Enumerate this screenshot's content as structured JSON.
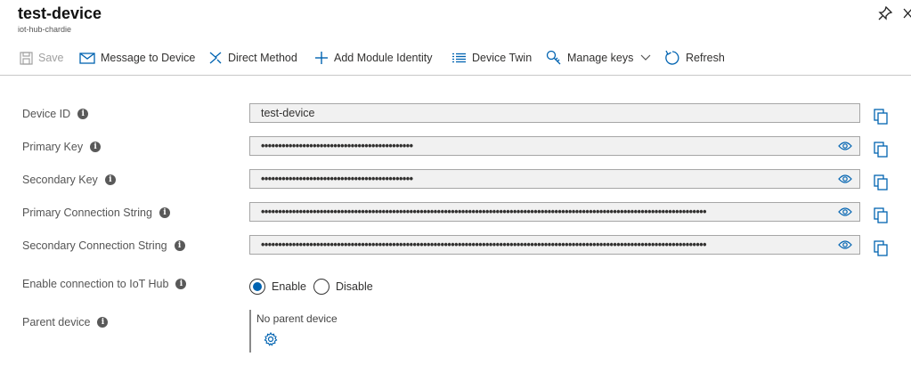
{
  "header": {
    "title": "test-device",
    "subtitle": "iot-hub-chardie"
  },
  "toolbar": {
    "save": "Save",
    "message": "Message to Device",
    "direct": "Direct Method",
    "add_module": "Add Module Identity",
    "twin": "Device Twin",
    "keys": "Manage keys",
    "refresh": "Refresh"
  },
  "fields": [
    {
      "label": "Device ID",
      "value": "test-device",
      "masked": false
    },
    {
      "label": "Primary Key",
      "value": "••••••••••••••••••••••••••••••••••••••••••••",
      "masked": true
    },
    {
      "label": "Secondary Key",
      "value": "••••••••••••••••••••••••••••••••••••••••••••",
      "masked": true
    },
    {
      "label": "Primary Connection String",
      "value": "•••••••••••••••••••••••••••••••••••••••••••••••••••••••••••••••••••••••••••••••••••••••••••••••••••••••••••••••••••••••••••••••••",
      "masked": true
    },
    {
      "label": "Secondary Connection String",
      "value": "•••••••••••••••••••••••••••••••••••••••••••••••••••••••••••••••••••••••••••••••••••••••••••••••••••••••••••••••••••••••••••••••••",
      "masked": true
    }
  ],
  "connection": {
    "label": "Enable connection to IoT Hub",
    "enable": "Enable",
    "disable": "Disable",
    "selected": "Enable"
  },
  "parent": {
    "label": "Parent device",
    "value": "No parent device"
  },
  "colors": {
    "accent": "#0063b1",
    "field_bg": "#f1f1f1",
    "icon_blue": "#0078d4"
  }
}
